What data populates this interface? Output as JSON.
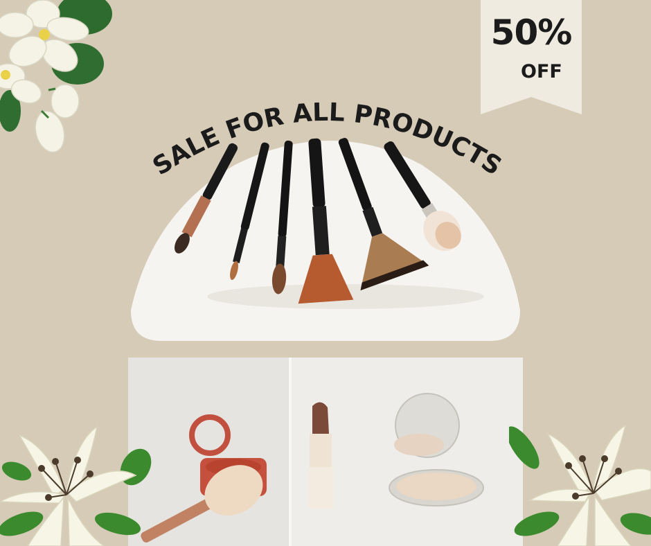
{
  "badge": {
    "percent": "50%",
    "off": "OFF"
  },
  "headline": {
    "text": "SALE FOR ALL PRODUCTS"
  },
  "colors": {
    "background": "#d6cbb7",
    "ribbon": "#efebe1",
    "text": "#1b1b1b",
    "card": "#f6f4f1"
  },
  "icons": {
    "top_left": "jasmine-flowers-icon",
    "bottom_left": "lily-flower-icon",
    "bottom_right": "lily-flower-icon"
  },
  "photos": {
    "top": "makeup-brushes-photo",
    "bottom": "cosmetics-products-photo"
  }
}
